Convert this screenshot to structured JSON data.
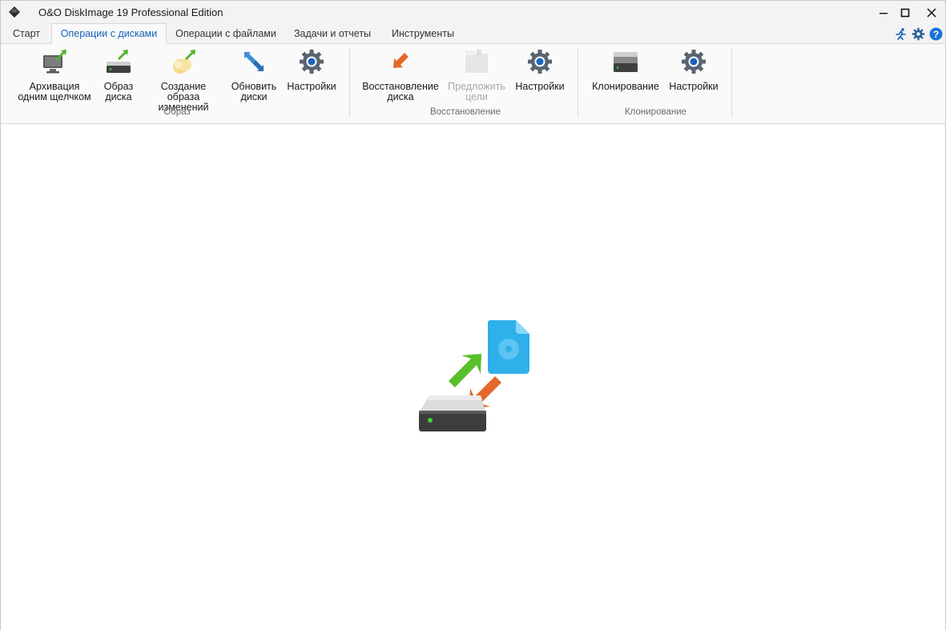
{
  "window": {
    "title": "O&O DiskImage 19 Professional Edition",
    "controls": [
      "minimize",
      "maximize",
      "close"
    ]
  },
  "tabs": [
    {
      "label": "Старт",
      "active": false
    },
    {
      "label": "Операции с дисками",
      "active": true
    },
    {
      "label": "Операции с файлами",
      "active": false
    },
    {
      "label": "Задачи и отчеты",
      "active": false
    },
    {
      "label": "Инструменты",
      "active": false
    }
  ],
  "tabbar_icons": [
    "run-icon",
    "gear-icon",
    "help-icon"
  ],
  "ribbon": {
    "groups": [
      {
        "label": "Образ",
        "buttons": [
          {
            "line1": "Архивация",
            "line2": "одним щелчком",
            "icon": "one-click-backup-icon",
            "enabled": true
          },
          {
            "line1": "Образ",
            "line2": "диска",
            "icon": "drive-image-icon",
            "enabled": true
          },
          {
            "line1": "Создание образа",
            "line2": "изменений",
            "icon": "incremental-image-icon",
            "enabled": true
          },
          {
            "line1": "Обновить",
            "line2": "диски",
            "icon": "refresh-drives-icon",
            "enabled": true
          },
          {
            "line1": "Настройки",
            "line2": "",
            "icon": "gear-icon",
            "enabled": true
          }
        ]
      },
      {
        "label": "Восстановление",
        "buttons": [
          {
            "line1": "Восстановление",
            "line2": "диска",
            "icon": "restore-drive-icon",
            "enabled": true
          },
          {
            "line1": "Предложить",
            "line2": "цели",
            "icon": "propose-target-icon",
            "enabled": false
          },
          {
            "line1": "Настройки",
            "line2": "",
            "icon": "gear-icon",
            "enabled": true
          }
        ]
      },
      {
        "label": "Клонирование",
        "buttons": [
          {
            "line1": "Клонирование",
            "line2": "",
            "icon": "clone-drive-icon",
            "enabled": true
          },
          {
            "line1": "Настройки",
            "line2": "",
            "icon": "gear-icon",
            "enabled": true
          }
        ]
      }
    ]
  },
  "main": {
    "illustration": "drive-image-illustration"
  },
  "colors": {
    "accent": "#1560b6",
    "green_arrow": "#5ac02a",
    "orange_arrow": "#e4682a",
    "file_blue": "#29a8e6"
  }
}
